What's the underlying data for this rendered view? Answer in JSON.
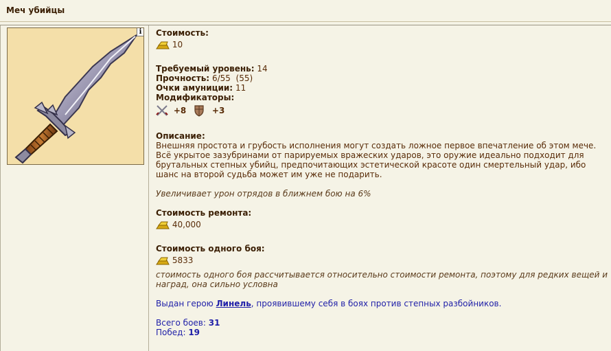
{
  "title": "Меч убийцы",
  "info_badge": "i",
  "cost": {
    "label": "Стоимость:",
    "value": "10"
  },
  "req_level": {
    "label": "Требуемый уровень:",
    "value": "14"
  },
  "durability": {
    "label": "Прочность:",
    "value": "6/55  (55)"
  },
  "ammo": {
    "label": "Очки амуниции:",
    "value": "11"
  },
  "modifiers": {
    "label": "Модификаторы:",
    "items": [
      {
        "icon": "crossed-swords-icon",
        "value": "+8"
      },
      {
        "icon": "shield-icon",
        "value": "+3"
      }
    ]
  },
  "description": {
    "label": "Описание:",
    "text": "Внешняя простота и грубость исполнения могут создать ложное первое впечатление об этом мече. Всё укрытое зазубринами от парируемых вражеских ударов, это оружие идеально подходит для брутальных степных убийц, предпочитающих эстетической красоте один смертельный удар, ибо шанс на второй судьба может им уже не подарить.",
    "effect": "Увеличивает урон отрядов в ближнем бою на 6%"
  },
  "repair": {
    "label": "Стоимость ремонта:",
    "value": "40,000"
  },
  "battle_cost": {
    "label": "Стоимость одного боя:",
    "value": "5833",
    "note": "стоимость одного боя рассчитывается относительно стоимости ремонта, поэтому для редких вещей и наград, она сильно условна"
  },
  "awarded": {
    "prefix": "Выдан герою ",
    "hero": "Линель",
    "suffix": ", проявившему себя в боях против степных разбойников."
  },
  "stats": {
    "battles_label": "Всего боев: ",
    "battles": "31",
    "wins_label": "Побед: ",
    "wins": "19"
  },
  "colors": {
    "background": "#f5f3e6",
    "text": "#592c08",
    "link": "#1f1fa8",
    "art_bg": "#f4dfa9"
  }
}
